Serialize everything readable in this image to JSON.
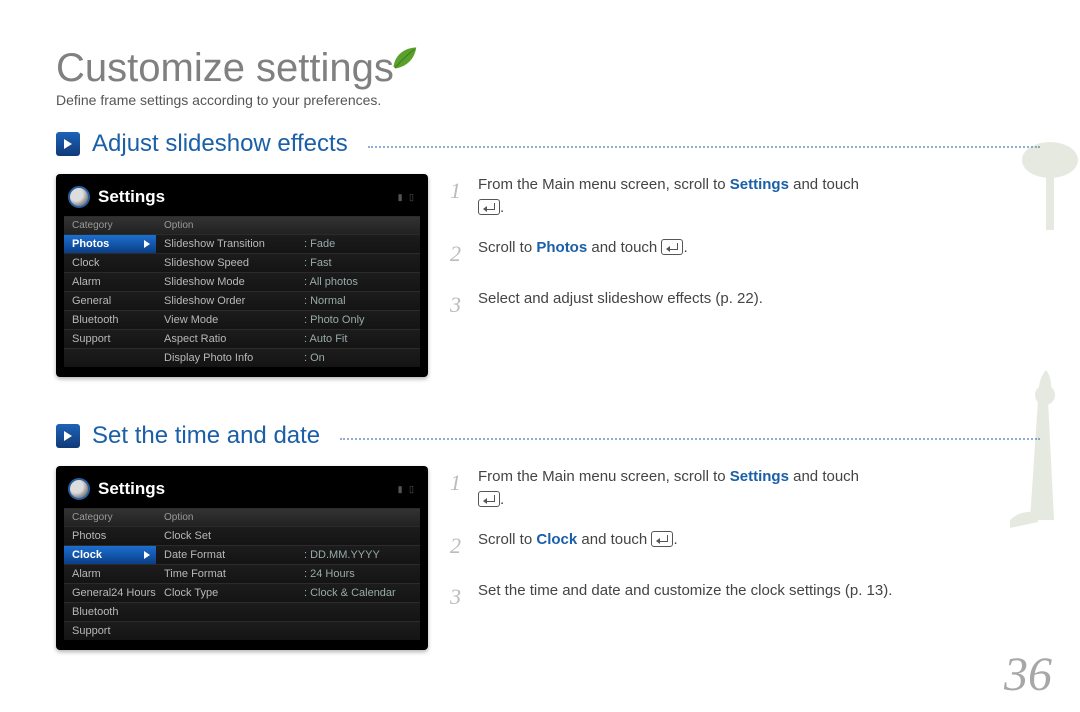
{
  "page": {
    "title": "Customize settings",
    "subtitle": "Define frame settings according to your preferences.",
    "number": "36"
  },
  "section1": {
    "title": "Adjust slideshow effects",
    "panel_title": "Settings",
    "headers": {
      "c1": "Category",
      "c2": "Option"
    },
    "categories": [
      "Photos",
      "Clock",
      "Alarm",
      "General",
      "Bluetooth",
      "Support"
    ],
    "selected_index": 0,
    "options": [
      {
        "label": "Slideshow Transition",
        "value": ": Fade"
      },
      {
        "label": "Slideshow Speed",
        "value": ": Fast"
      },
      {
        "label": "Slideshow Mode",
        "value": ": All photos"
      },
      {
        "label": "Slideshow Order",
        "value": ": Normal"
      },
      {
        "label": "View Mode",
        "value": ": Photo Only"
      },
      {
        "label": "Aspect Ratio",
        "value": ": Auto Fit"
      },
      {
        "label": "Display Photo Info",
        "value": ": On"
      }
    ],
    "steps": {
      "s1a": "From the Main menu screen, scroll to ",
      "s1b": "Settings",
      "s1c": " and touch ",
      "s1d": ".",
      "s2a": "Scroll to ",
      "s2b": "Photos",
      "s2c": " and touch ",
      "s2d": ".",
      "s3": "Select and adjust slideshow effects (p. 22)."
    }
  },
  "section2": {
    "title": "Set the time and date",
    "panel_title": "Settings",
    "headers": {
      "c1": "Category",
      "c2": "Option"
    },
    "categories": [
      "Photos",
      "Clock",
      "Alarm",
      "Genera l24 Hours",
      "Bluetooth",
      "Support"
    ],
    "categories_display": [
      "Photos",
      "Clock",
      "Alarm",
      "General24 Hours",
      "Bluetooth",
      "Support"
    ],
    "selected_index": 1,
    "options": [
      {
        "label": "Clock Set",
        "value": ""
      },
      {
        "label": "Date Format",
        "value": ": DD.MM.YYYY"
      },
      {
        "label": "Time Format",
        "value": ": 24 Hours"
      },
      {
        "label": "Clock Type",
        "value": ": Clock & Calendar"
      }
    ],
    "steps": {
      "s1a": "From the Main menu screen, scroll to ",
      "s1b": "Settings",
      "s1c": " and touch ",
      "s1d": ".",
      "s2a": "Scroll to ",
      "s2b": "Clock",
      "s2c": " and touch ",
      "s2d": ".",
      "s3": "Set the time and date and customize the clock settings (p. 13)."
    }
  }
}
